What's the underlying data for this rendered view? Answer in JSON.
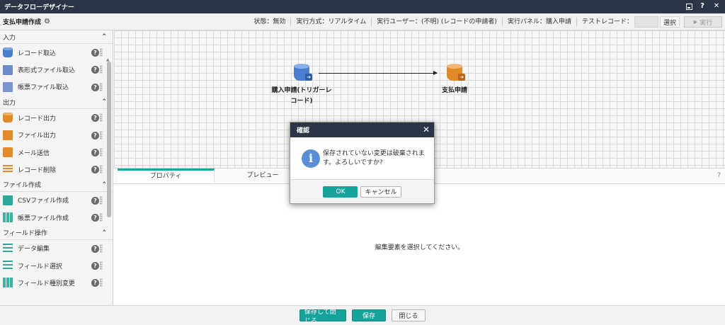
{
  "window": {
    "title": "データフローデザイナー"
  },
  "toolbar": {
    "flow_name": "支払申請作成",
    "status": "状態：無効",
    "exec_mode": "実行方式：リアルタイム",
    "exec_user": "実行ユーザー：(不明) (レコードの申請者)",
    "exec_panel": "実行パネル：購入申請",
    "test_record": "テストレコード：",
    "select_label": "選択",
    "run_label": "実行"
  },
  "sidebar": {
    "sections": [
      {
        "title": "入力",
        "items": [
          "レコード取込",
          "表形式ファイル取込",
          "帳票ファイル取込"
        ]
      },
      {
        "title": "出力",
        "items": [
          "レコード出力",
          "ファイル出力",
          "メール送信",
          "レコード削除"
        ]
      },
      {
        "title": "ファイル作成",
        "items": [
          "CSVファイル作成",
          "帳票ファイル作成"
        ]
      },
      {
        "title": "フィールド操作",
        "items": [
          "データ編集",
          "フィールド選択",
          "フィールド種別変更"
        ]
      }
    ]
  },
  "canvas": {
    "nodes": [
      {
        "label_line1": "購入申請(トリガーレ",
        "label_line2": "コード)"
      },
      {
        "label_line1": "支払申請"
      }
    ]
  },
  "panel": {
    "tabs": [
      "プロパティ",
      "プレビュー"
    ],
    "help": "?",
    "empty_message": "編集要素を選択してください。"
  },
  "footer": {
    "save_close": "保存して閉じる",
    "save": "保存",
    "close": "閉じる"
  },
  "dialog": {
    "title": "確認",
    "message_line1": "保存されていない変更は破棄されま",
    "message_line2": "す。よろしいですか?",
    "ok": "OK",
    "cancel": "キャンセル"
  },
  "colors": {
    "accent": "#16a39b",
    "header": "#2b3545",
    "blue": "#4a7fd0",
    "orange": "#e08a2a"
  }
}
